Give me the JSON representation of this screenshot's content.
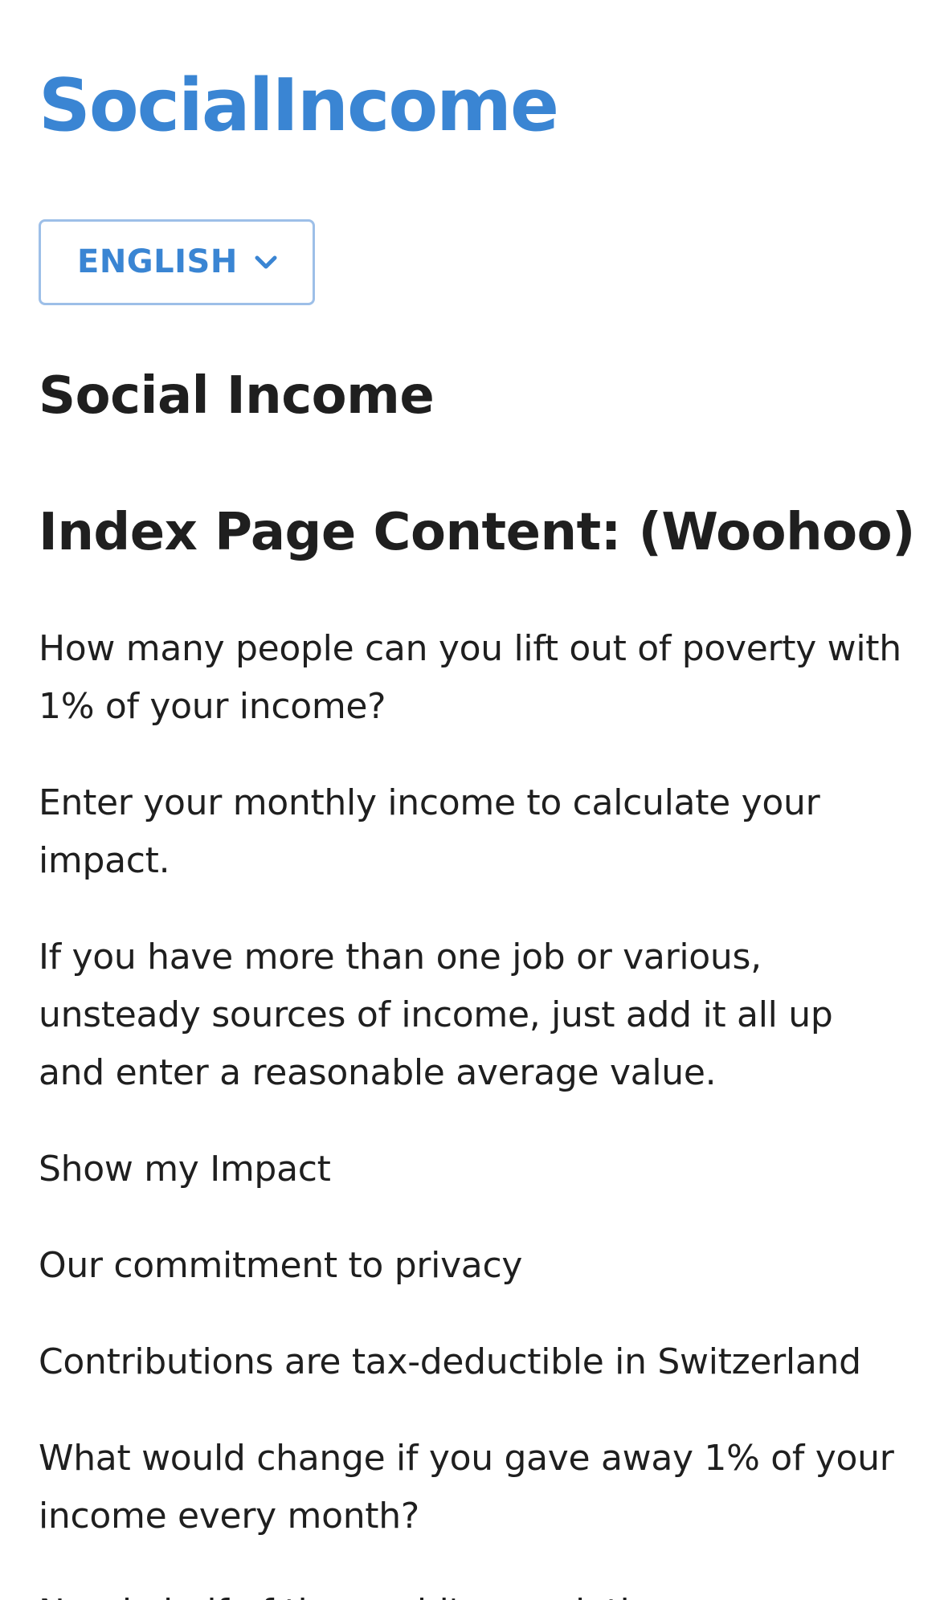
{
  "header": {
    "brand": "SocialIncome"
  },
  "language_select": {
    "selected": "ENGLISH",
    "icon": "chevron-down-icon",
    "accent_color": "#3a85d3",
    "border_color": "#9dbfe8"
  },
  "main": {
    "site_title": "Social Income",
    "content_title": "Index Page Content: (Woohoo)",
    "paragraphs": [
      "How many people can you lift out of poverty with 1% of your income?",
      "Enter your monthly income to calculate your impact.",
      "If you have more than one job or various, unsteady sources of income, just add it all up and enter a reasonable average value.",
      "Show my Impact",
      "Our commitment to privacy",
      "Contributions are tax-deductible in Switzerland",
      "What would change if you gave away 1% of your income every month?",
      "Nearly half of the world's population"
    ]
  }
}
